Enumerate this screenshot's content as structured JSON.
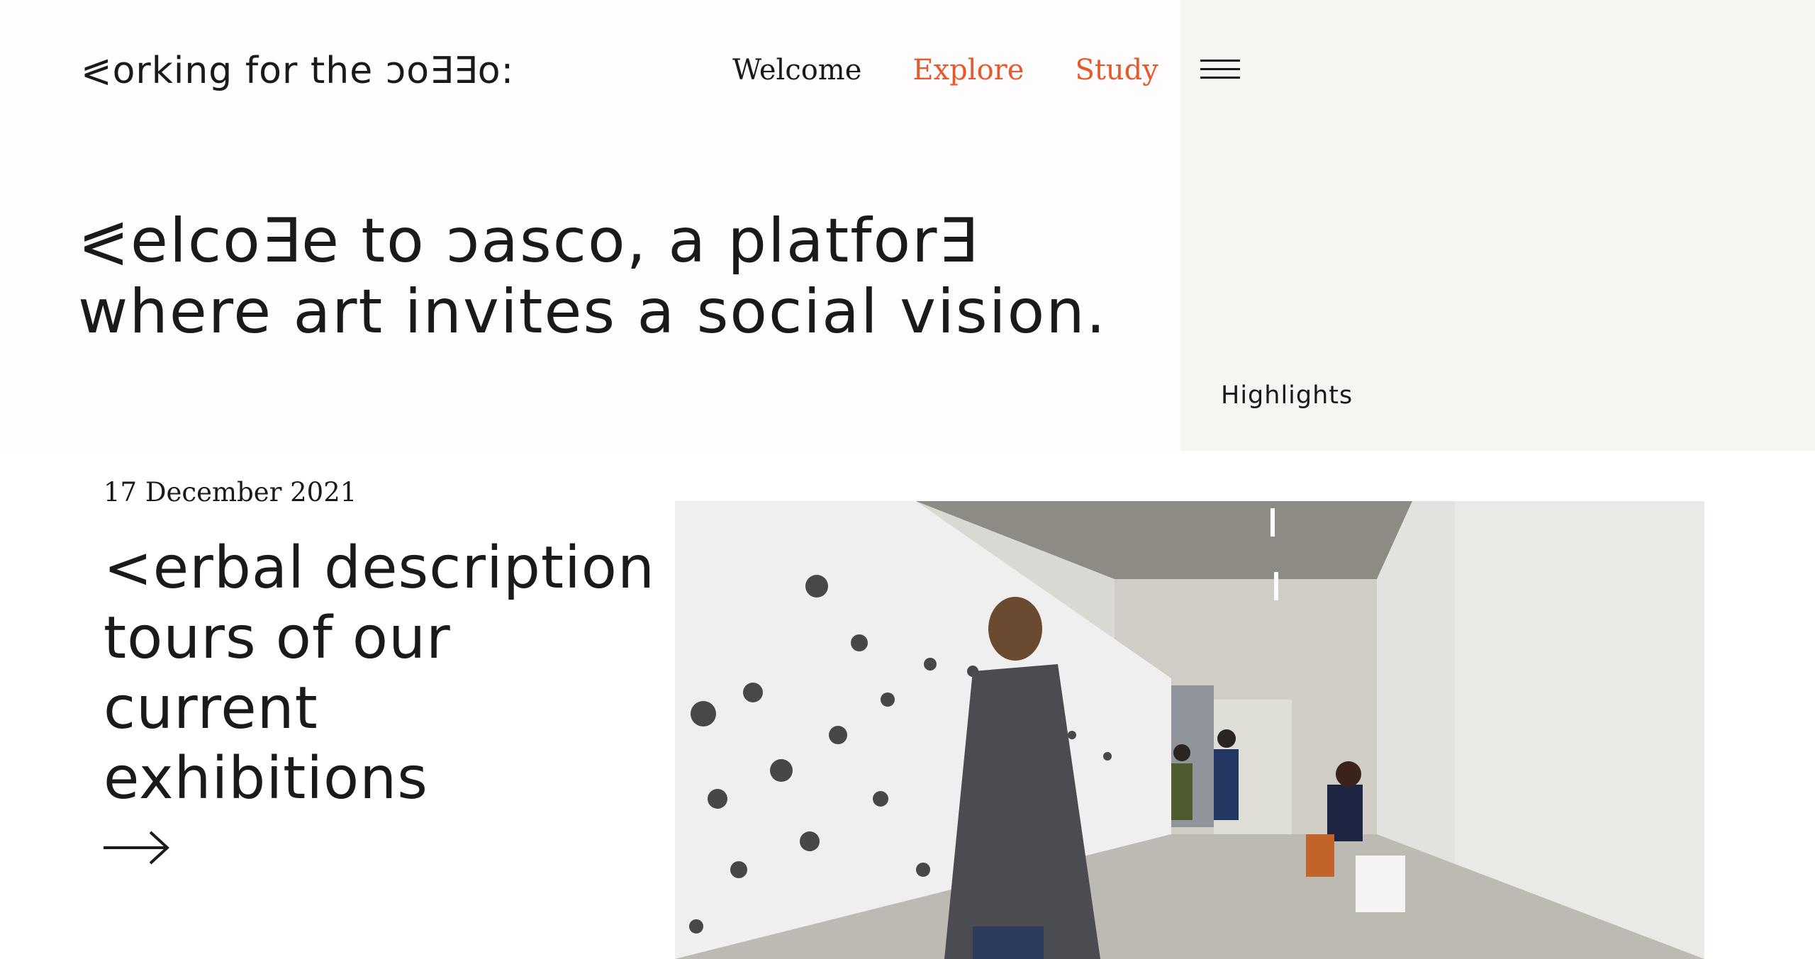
{
  "header": {
    "site_title": "⪕orking for the ↄo∃∃o:",
    "nav": {
      "welcome": "Welcome",
      "explore": "Explore",
      "study": "Study"
    },
    "menu_icon": "hamburger-menu-icon"
  },
  "side_panel": {
    "highlights_label": "Highlights"
  },
  "hero": {
    "heading_line_1": "⪕elco∃e to ↄasco, a platfor∃",
    "heading_line_2": "where art invites a social vision."
  },
  "post": {
    "date": "17 December 2021",
    "title_lines": [
      "<erbal description",
      "tours of our",
      "current",
      "exhibitions"
    ],
    "arrow_icon": "arrow-right-icon",
    "image_alt": "Visitors in an exhibition hall with drawings on a white wall"
  },
  "colors": {
    "accent": "#e6592d",
    "text": "#1a1a1a",
    "panel": "#f6f5f1",
    "hero_bg": "#fefcfc"
  }
}
